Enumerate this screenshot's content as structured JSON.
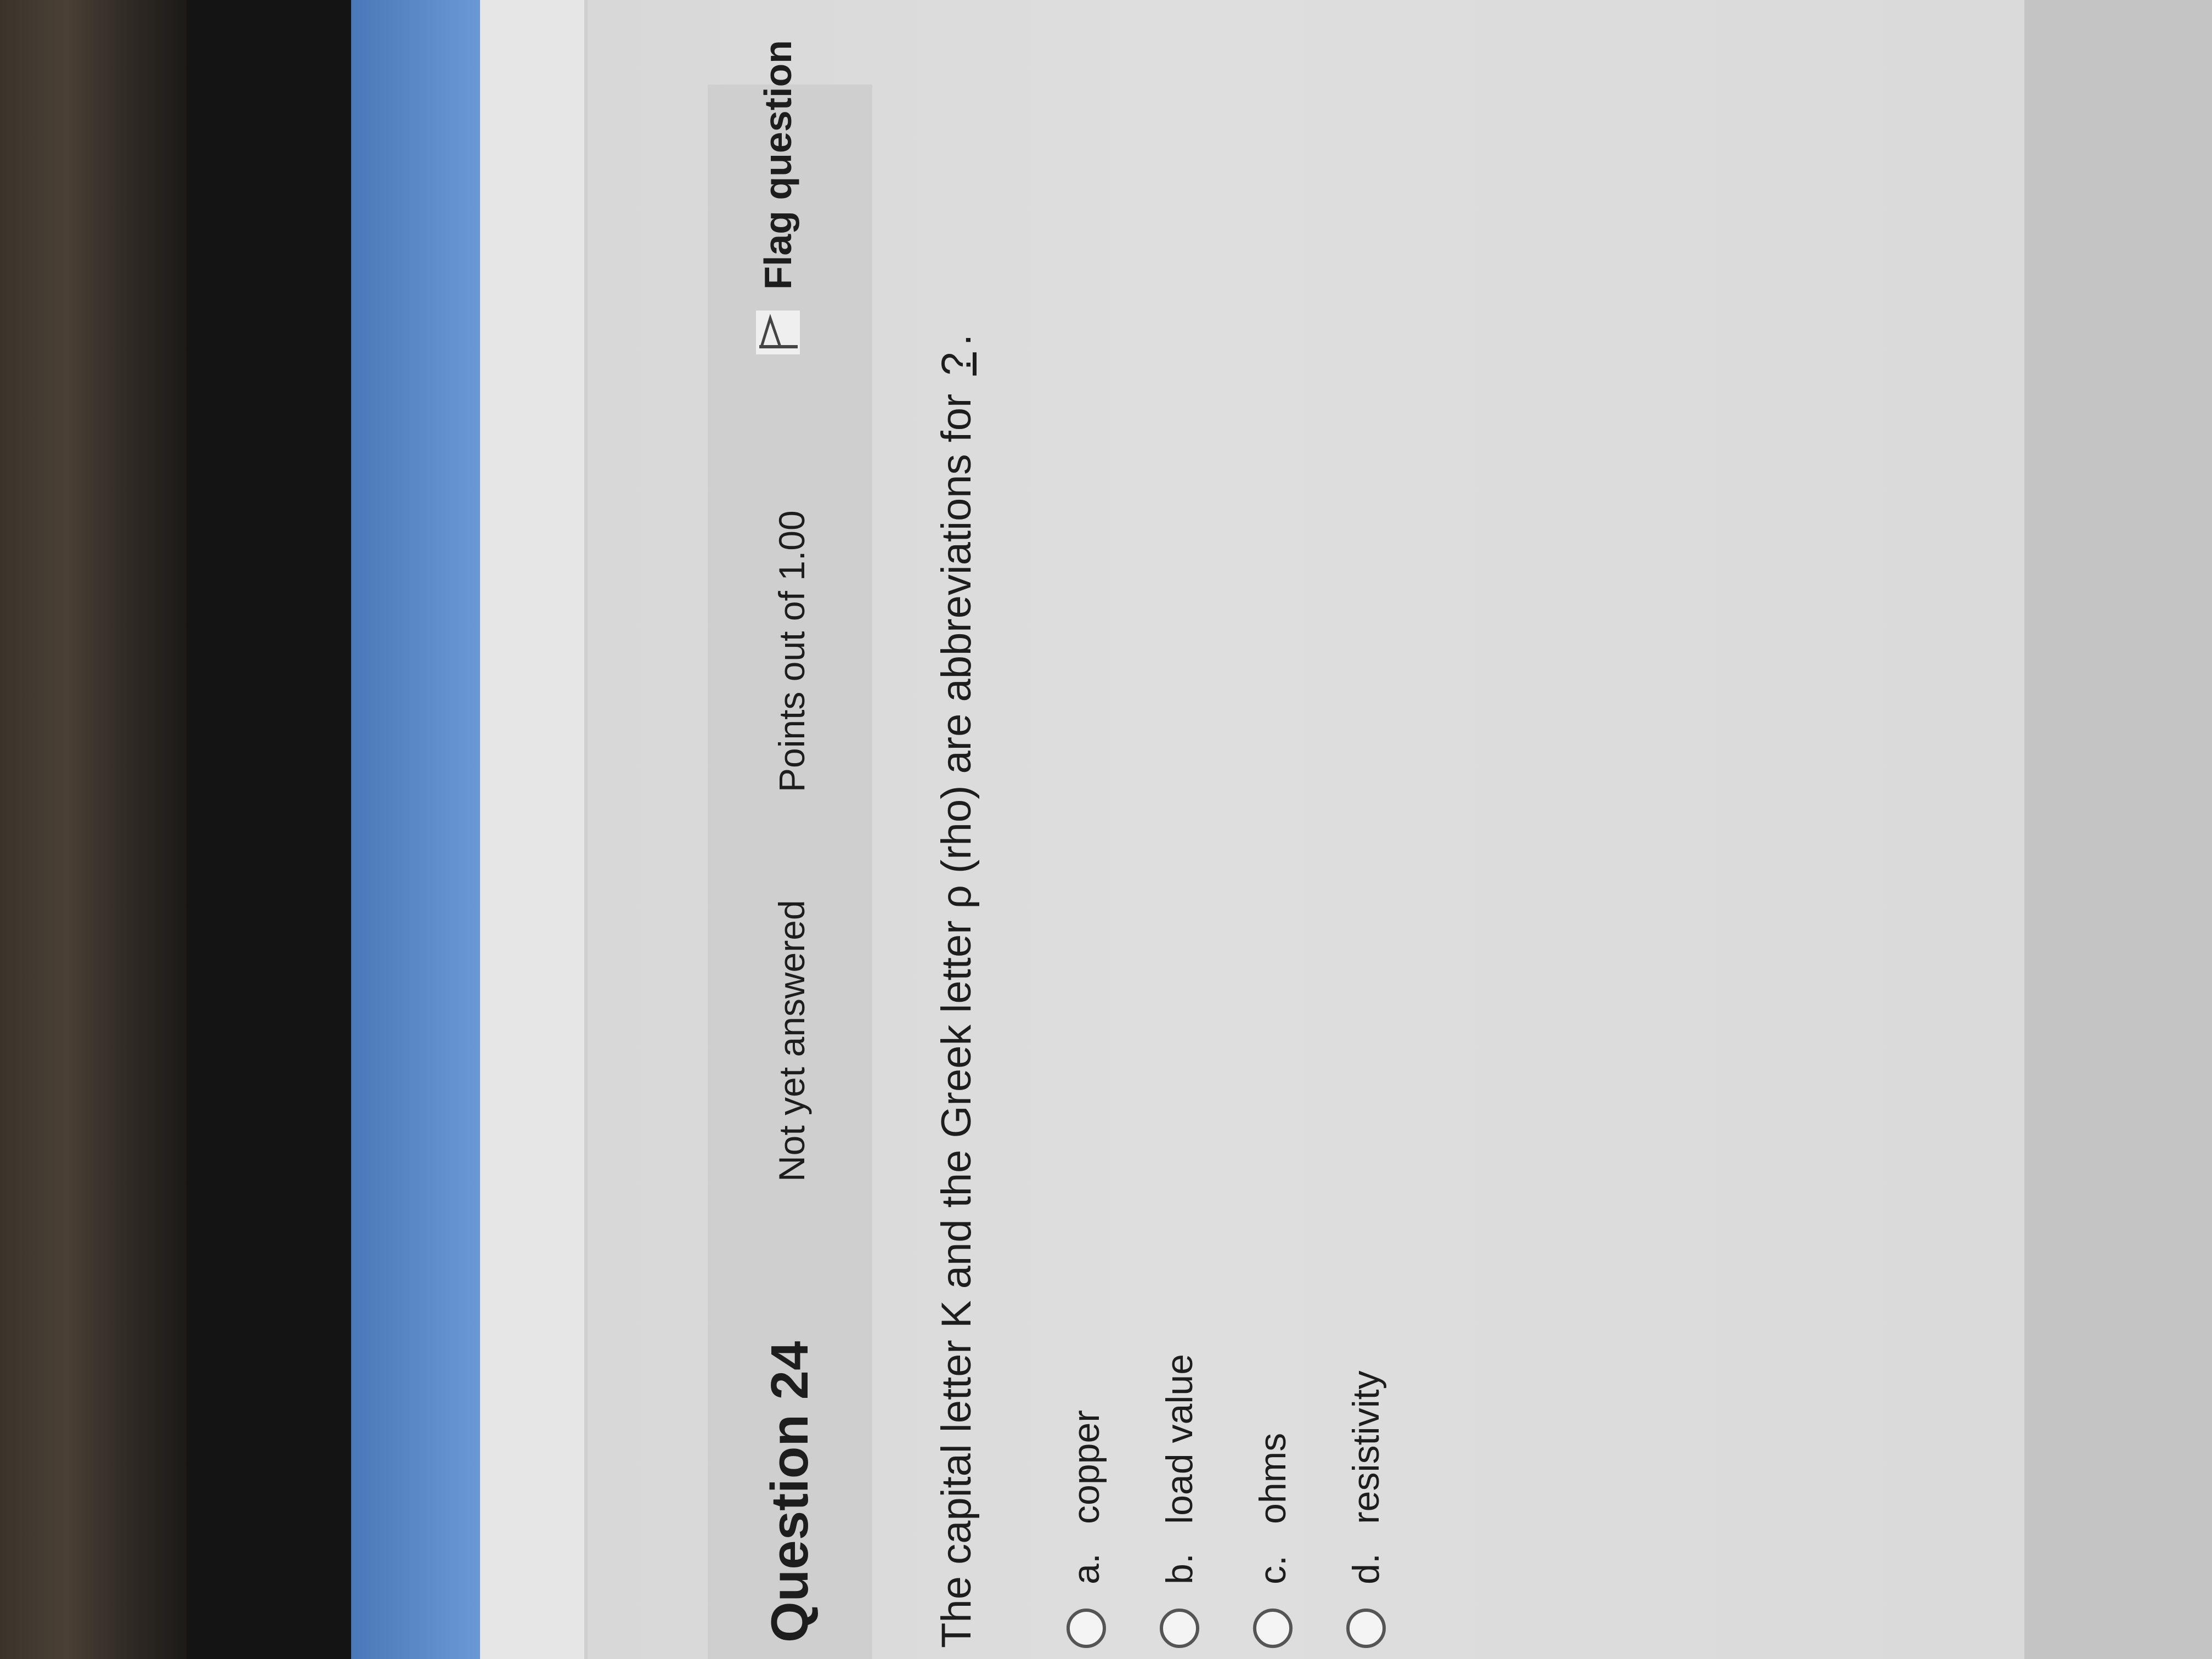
{
  "question": {
    "title": "Question 24",
    "status": "Not yet answered",
    "points": "Points out of 1.00",
    "flag_label": "Flag question",
    "text_prefix": "The capital letter K and the Greek letter ρ (rho) are abbreviations for ",
    "blank": "?",
    "text_suffix": ".",
    "options": [
      {
        "letter": "a.",
        "label": "copper"
      },
      {
        "letter": "b.",
        "label": "load value"
      },
      {
        "letter": "c.",
        "label": "ohms"
      },
      {
        "letter": "d.",
        "label": "resistivity"
      }
    ]
  },
  "colors": {
    "header_bg": "#cfcfcf",
    "page_bg": "#dedede",
    "accent_blue": "#5b88c8"
  },
  "icons": {
    "flag": "flag-icon",
    "radio": "radio-unchecked-icon"
  }
}
